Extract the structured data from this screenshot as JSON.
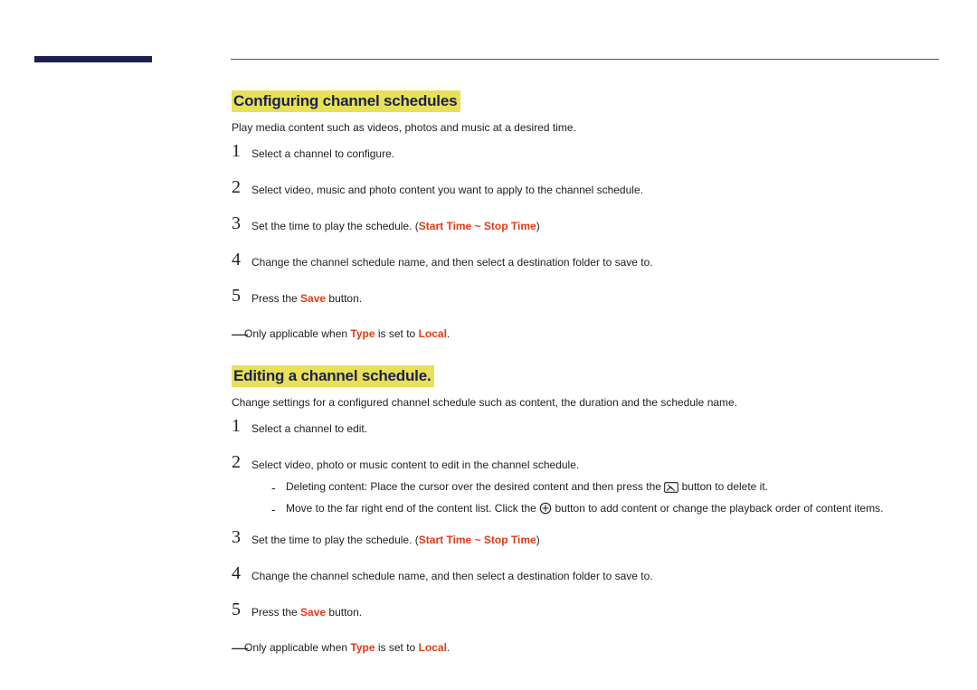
{
  "section1": {
    "title": "Configuring channel schedules",
    "intro": "Play media content such as videos, photos and music at a desired time.",
    "steps": {
      "s1": "Select a channel to configure.",
      "s2": "Select video, music and photo content you want to apply to the channel schedule.",
      "s3_a": "Set the time to play the schedule. (",
      "s3_red": "Start Time ~ Stop Time",
      "s3_b": ")",
      "s4": "Change the channel schedule name, and then select a destination folder to save to.",
      "s5_a": "Press the ",
      "s5_red": "Save",
      "s5_b": " button."
    },
    "note": {
      "a": "Only applicable when ",
      "red1": "Type",
      "b": " is set to ",
      "red2": "Local",
      "c": "."
    }
  },
  "section2": {
    "title": "Editing a channel schedule.",
    "intro": "Change settings for a configured channel schedule such as content, the duration and the schedule name.",
    "steps": {
      "s1": "Select a channel to edit.",
      "s2": "Select video, photo or music content to edit in the channel schedule.",
      "s2_sub": {
        "d1_a": "Deleting content: Place the cursor over the desired content and then press the ",
        "d1_b": " button to delete it.",
        "d2_a": "Move to the far right end of the content list. Click the ",
        "d2_b": " button to add content or change the playback order of content items."
      },
      "s3_a": "Set the time to play the schedule. (",
      "s3_red": "Start Time ~ Stop Time",
      "s3_b": ")",
      "s4": "Change the channel schedule name, and then select a destination folder to save to.",
      "s5_a": "Press the ",
      "s5_red": "Save",
      "s5_b": " button."
    },
    "note": {
      "a": "Only applicable when ",
      "red1": "Type",
      "b": " is set to ",
      "red2": "Local",
      "c": "."
    }
  },
  "nums": {
    "n1": "1",
    "n2": "2",
    "n3": "3",
    "n4": "4",
    "n5": "5"
  },
  "dash": "-"
}
